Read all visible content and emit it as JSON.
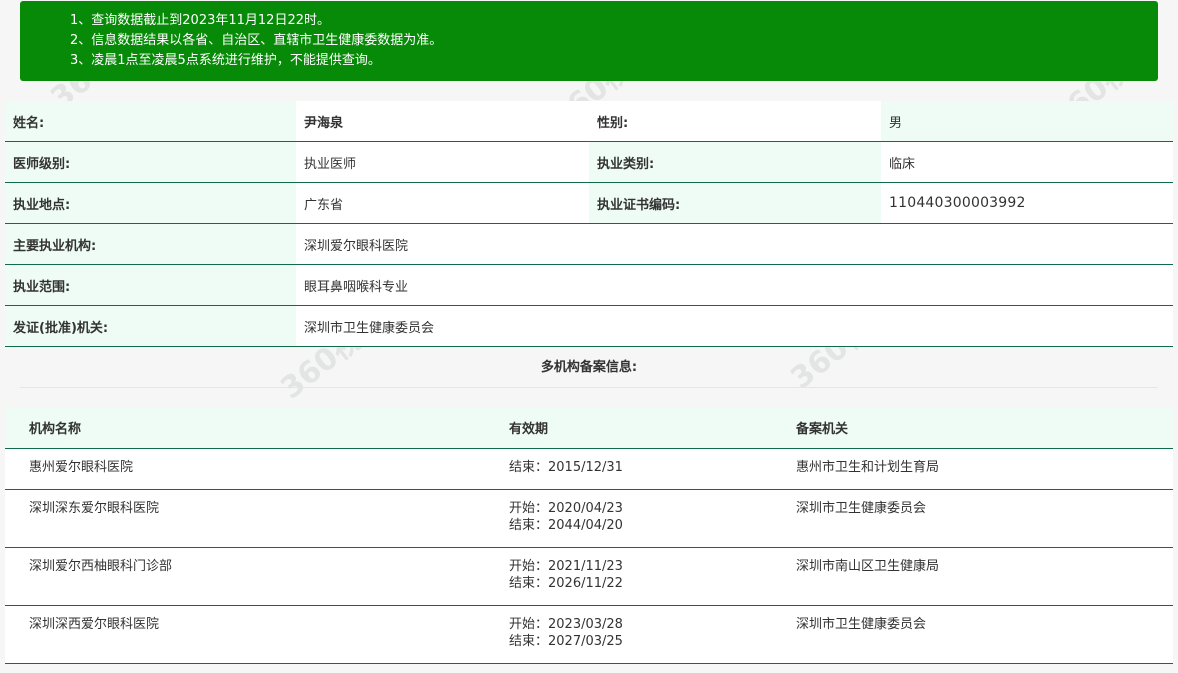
{
  "notice": {
    "lines": [
      "1、查询数据截止到2023年11月12日22时。",
      "2、信息数据结果以各省、自治区、直辖市卫生健康委数据为准。",
      "3、凌晨1点至凌晨5点系统进行维护，不能提供查询。"
    ]
  },
  "doctor": {
    "name_label": "姓名:",
    "name": "尹海泉",
    "gender_label": "性别:",
    "gender": "男",
    "level_label": "医师级别:",
    "level": "执业医师",
    "category_label": "执业类别:",
    "category": "临床",
    "location_label": "执业地点:",
    "location": "广东省",
    "cert_label": "执业证书编码:",
    "cert": "110440300003992",
    "org_label": "主要执业机构:",
    "org": "深圳爱尔眼科医院",
    "scope_label": "执业范围:",
    "scope": "眼耳鼻咽喉科专业",
    "issuer_label": "发证(批准)机关:",
    "issuer": "深圳市卫生健康委员会"
  },
  "multi": {
    "title": "多机构备案信息:",
    "headers": [
      "机构名称",
      "有效期",
      "备案机关"
    ],
    "rows": [
      {
        "name": "惠州爱尔眼科医院",
        "start": "",
        "end": "结束：2015/12/31",
        "authority": "惠州市卫生和计划生育局"
      },
      {
        "name": "深圳深东爱尔眼科医院",
        "start": "开始：2020/04/23",
        "end": "结束：2044/04/20",
        "authority": "深圳市卫生健康委员会"
      },
      {
        "name": "深圳爱尔西柚眼科门诊部",
        "start": "开始：2021/11/23",
        "end": "结束：2026/11/22",
        "authority": "深圳市南山区卫生健康局"
      },
      {
        "name": "深圳深西爱尔眼科医院",
        "start": "开始：2023/03/28",
        "end": "结束：2027/03/25",
        "authority": "深圳市卫生健康委员会"
      }
    ]
  },
  "watermark": "360视界",
  "colors": {
    "notice_bg": "#078a07",
    "label_bg": "#effcf5",
    "border": "#0f6b4a"
  }
}
